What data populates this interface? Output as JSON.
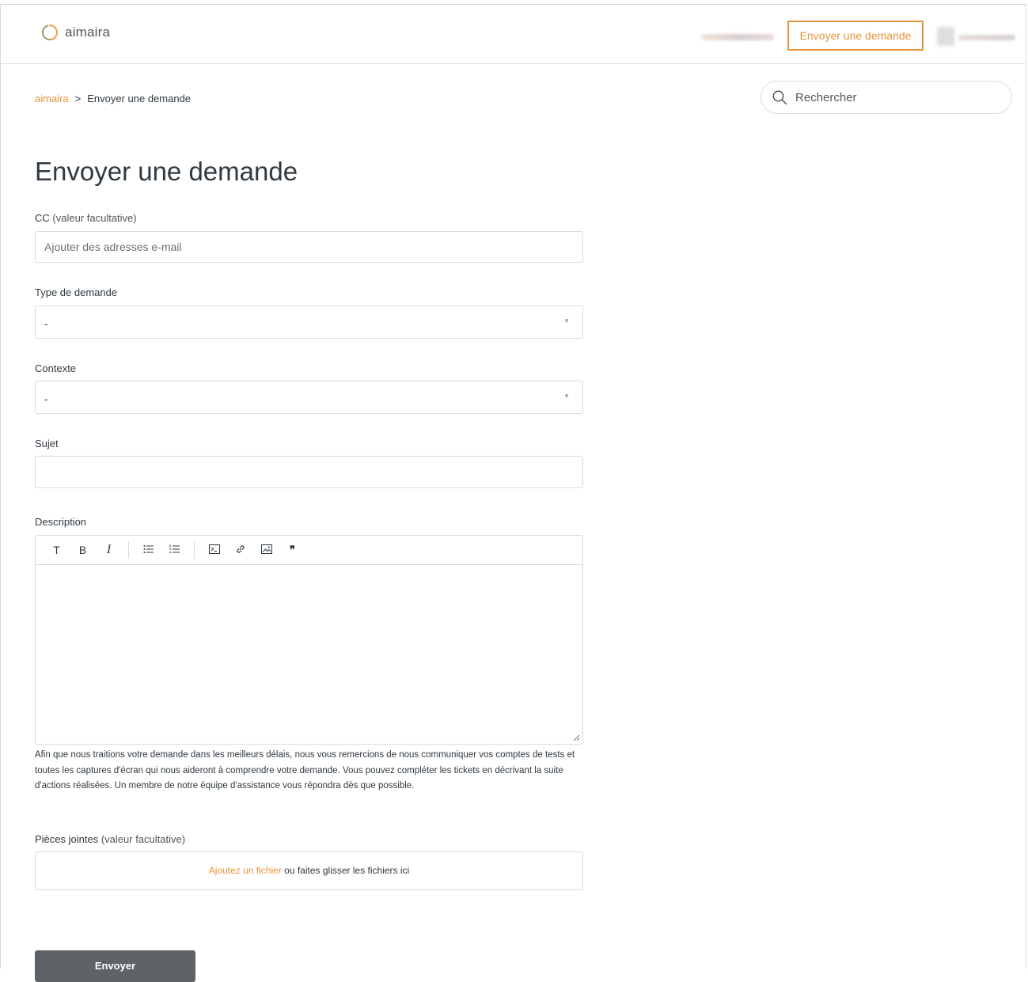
{
  "header": {
    "logo_text": "aimaira",
    "submit_request_link": "Envoyer une demande",
    "brand_color": "#e8953a"
  },
  "breadcrumb": {
    "home": "aimaira",
    "separator": ">",
    "current": "Envoyer une demande"
  },
  "search": {
    "placeholder": "Rechercher"
  },
  "page": {
    "title": "Envoyer une demande"
  },
  "form": {
    "cc": {
      "label": "CC",
      "optional": "(valeur facultative)",
      "placeholder": "Ajouter des adresses e-mail"
    },
    "request_type": {
      "label": "Type de demande",
      "value": "-"
    },
    "context": {
      "label": "Contexte",
      "value": "-"
    },
    "subject": {
      "label": "Sujet",
      "value": ""
    },
    "description": {
      "label": "Description",
      "toolbar": {
        "text": "T",
        "bold": "B",
        "italic": "I"
      },
      "hint": "Afin que nous traitions votre demande dans les meilleurs délais, nous vous remercions de nous communiquer vos comptes de tests et toutes les captures d'écran qui nous aideront à comprendre votre demande. Vous pouvez compléter les tickets en décrivant la suite d'actions réalisées. Un membre de notre équipe d'assistance vous répondra dès que possible."
    },
    "attachments": {
      "label": "Pièces jointes",
      "optional": "(valeur facultative)",
      "add_link": "Ajoutez un fichier",
      "drop_text": " ou faites glisser les fichiers ici"
    },
    "submit_label": "Envoyer"
  }
}
